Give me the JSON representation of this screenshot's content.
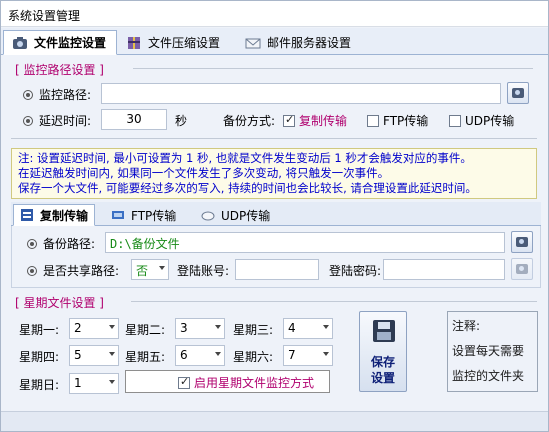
{
  "window": {
    "title": "系统设置管理"
  },
  "tabs": [
    {
      "label": "文件监控设置",
      "icon": "camera-icon",
      "active": true
    },
    {
      "label": "文件压缩设置",
      "icon": "archive-icon",
      "active": false
    },
    {
      "label": "邮件服务器设置",
      "icon": "mail-icon",
      "active": false
    }
  ],
  "monitor": {
    "legend": "[ 监控路径设置 ]",
    "path_label": "监控路径:",
    "path_value": "",
    "delay_label": "延迟时间:",
    "delay_value": "30",
    "delay_unit": "秒",
    "backup_mode_label": "备份方式:",
    "backup_options": [
      {
        "label": "复制传输",
        "checked": true
      },
      {
        "label": "FTP传输",
        "checked": false
      },
      {
        "label": "UDP传输",
        "checked": false
      }
    ]
  },
  "note": {
    "lines": [
      "注: 设置延迟时间, 最小可设置为  1  秒, 也就是文件发生变动后  1  秒才会触发对应的事件。",
      "在延迟触发时间内, 如果同一个文件发生了多次变动, 将只触发一次事件。",
      "保存一个大文件, 可能要经过多次的写入, 持续的时间也会比较长, 请合理设置此延迟时间。"
    ]
  },
  "subtabs": [
    {
      "label": "复制传输",
      "icon": "copy-icon",
      "active": true
    },
    {
      "label": "FTP传输",
      "icon": "ftp-icon",
      "active": false
    },
    {
      "label": "UDP传输",
      "icon": "cloud-icon",
      "active": false
    }
  ],
  "copy_transfer": {
    "backup_path_label": "备份路径:",
    "backup_path_value": "D:\\备份文件",
    "shared_path_label": "是否共享路径:",
    "shared_path_value": "否",
    "login_account_label": "登陆账号:",
    "login_account_value": "",
    "login_password_label": "登陆密码:",
    "login_password_value": ""
  },
  "weekly": {
    "legend": "[ 星期文件设置 ]",
    "days": [
      {
        "label": "星期一:",
        "value": "2"
      },
      {
        "label": "星期二:",
        "value": "3"
      },
      {
        "label": "星期三:",
        "value": "4"
      },
      {
        "label": "星期四:",
        "value": "5"
      },
      {
        "label": "星期五:",
        "value": "6"
      },
      {
        "label": "星期六:",
        "value": "7"
      },
      {
        "label": "星期日:",
        "value": "1"
      }
    ],
    "enable_label": "启用星期文件监控方式",
    "enable_checked": true
  },
  "save_button": {
    "line1": "保存",
    "line2": "设置"
  },
  "note_panel": {
    "lines": [
      "注释:",
      "设置每天需要",
      "监控的文件夹"
    ]
  }
}
